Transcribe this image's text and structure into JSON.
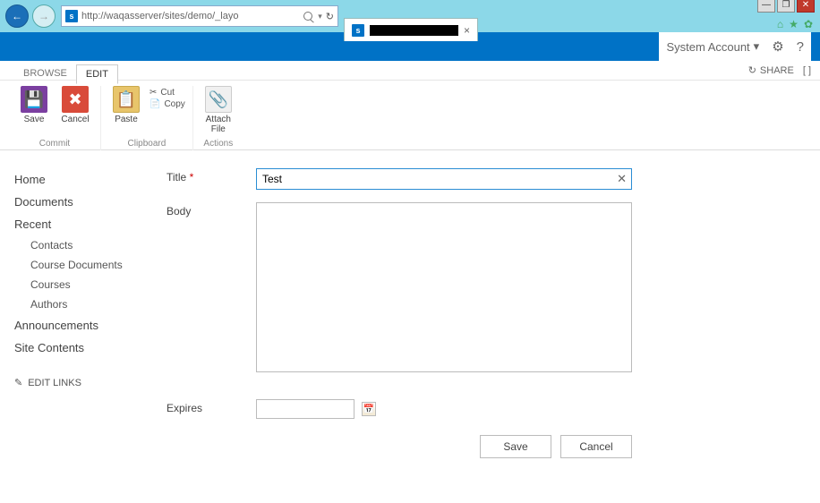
{
  "browser": {
    "url": "http://waqasserver/sites/demo/_layo",
    "refresh_glyph": "↻"
  },
  "window_controls": {
    "min": "—",
    "max": "❐",
    "close": "✕"
  },
  "suite": {
    "account": "System Account",
    "gear": "⚙",
    "help": "?"
  },
  "share_bar": {
    "share": "SHARE",
    "focus": "[ ]"
  },
  "tabs": {
    "browse": "BROWSE",
    "edit": "EDIT"
  },
  "ribbon": {
    "save": "Save",
    "cancel": "Cancel",
    "paste": "Paste",
    "cut": "Cut",
    "copy": "Copy",
    "attach": "Attach File",
    "group_commit": "Commit",
    "group_clipboard": "Clipboard",
    "group_actions": "Actions"
  },
  "nav": {
    "home": "Home",
    "documents": "Documents",
    "recent": "Recent",
    "contacts": "Contacts",
    "course_docs": "Course Documents",
    "courses": "Courses",
    "authors": "Authors",
    "announcements": "Announcements",
    "site_contents": "Site Contents",
    "edit_links": "EDIT LINKS"
  },
  "form": {
    "title_label": "Title",
    "title_value": "Test",
    "body_label": "Body",
    "expires_label": "Expires",
    "expires_value": "",
    "save_btn": "Save",
    "cancel_btn": "Cancel",
    "clear_glyph": "✕"
  }
}
